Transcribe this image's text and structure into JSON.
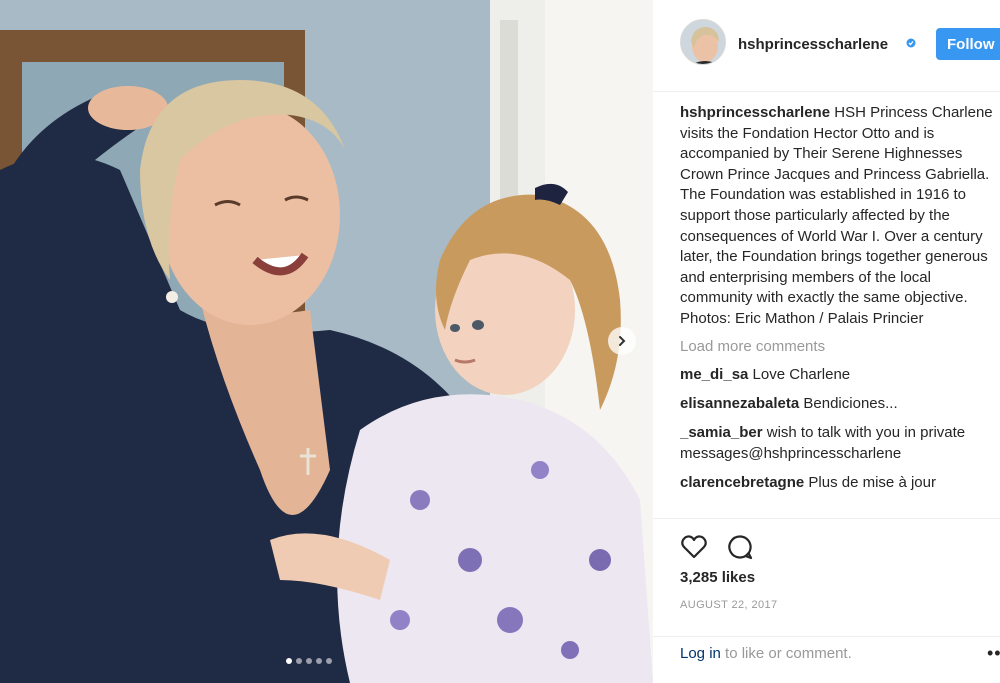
{
  "post": {
    "photo_alt": "Princess holding toddler",
    "carousel": {
      "slide_count": 5,
      "active_index": 0
    },
    "next_icon": "chevron-right-icon"
  },
  "header": {
    "username": "hshprincesscharlene",
    "verified_icon": "verified-badge-icon",
    "follow_label": "Follow"
  },
  "caption": {
    "username": "hshprincesscharlene",
    "text": " HSH Princess Charlene visits the Fondation Hector Otto and is accompanied by Their Serene Highnesses Crown Prince Jacques and Princess Gabriella. The Foundation was established in 1916 to support those particularly affected by the consequences of World War I. Over a century later, the Foundation brings together generous and enterprising members of the local community with exactly the same objective.",
    "credit": "Photos: Eric Mathon / Palais Princier"
  },
  "load_more_label": "Load more comments",
  "comments": [
    {
      "username": "me_di_sa",
      "text": " Love Charlene"
    },
    {
      "username": "elisannezabaleta",
      "text": " Bendiciones..."
    },
    {
      "username": "_samia_ber",
      "text": " wish to talk with you in private messages@hshprincesscharlene"
    },
    {
      "username": "clarencebretagne",
      "text": " Plus de mise à jour"
    }
  ],
  "actions": {
    "like_icon": "heart-icon",
    "comment_icon": "comment-bubble-icon"
  },
  "likes_label": "3,285 likes",
  "date_label": "AUGUST 22, 2017",
  "footer": {
    "login_link": "Log in",
    "login_suffix": " to like or comment.",
    "more_icon": "more-options-icon"
  },
  "colors": {
    "accent": "#3897f0",
    "text": "#262626",
    "muted": "#999999",
    "link": "#003569"
  }
}
